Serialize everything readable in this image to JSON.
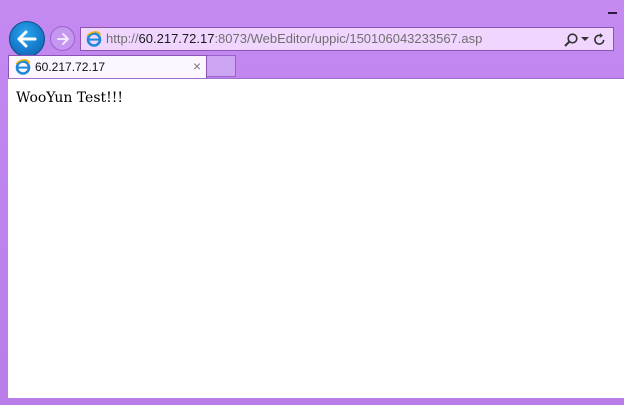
{
  "window": {
    "minimize_icon": "minimize-icon"
  },
  "nav": {
    "back_icon": "arrow-left-icon",
    "forward_icon": "arrow-right-icon"
  },
  "address": {
    "scheme": "http://",
    "host": "60.217.72.17",
    "rest": ":8073/WebEditor/uppic/150106043233567.asp",
    "icons": [
      "ie-icon",
      "search-icon",
      "dropdown-icon",
      "refresh-icon"
    ]
  },
  "tabs": [
    {
      "title": "60.217.72.17",
      "close": "×"
    }
  ],
  "page": {
    "body_text": "WooYun Test!!!"
  }
}
